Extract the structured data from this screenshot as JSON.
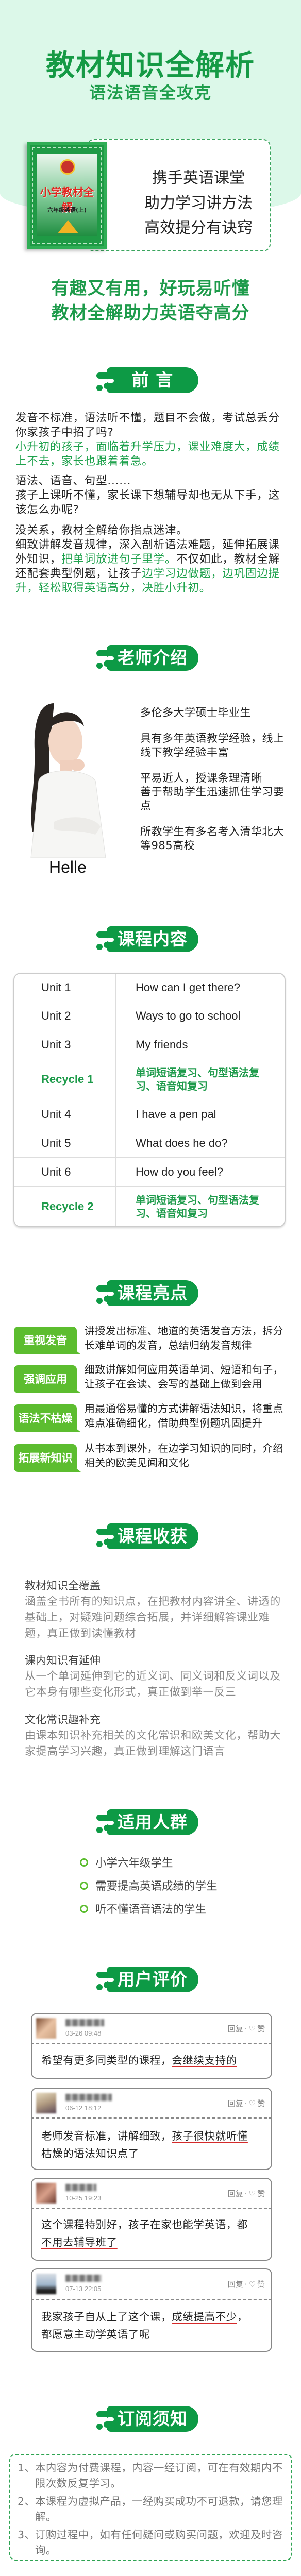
{
  "header": {
    "title": "教材知识全解析",
    "subtitle": "语法语音全攻克"
  },
  "book": {
    "series": "小学教材全解",
    "grade": "六年级英语(上)"
  },
  "promo_box": {
    "lines": [
      "携手英语课堂",
      "助力学习讲方法",
      "高效提分有诀窍"
    ]
  },
  "slogan": {
    "lines": [
      "有趣又有用，好玩易听懂",
      "教材全解助力英语夺高分"
    ]
  },
  "sections": {
    "preface": "前 言",
    "teacher": "老师介绍",
    "content": "课程内容",
    "highlights": "课程亮点",
    "gains": "课程收获",
    "audience": "适用人群",
    "reviews": "用户评价",
    "notice": "订阅须知"
  },
  "preface": {
    "l1": "发音不标准，语法听不懂，题目不会做，考试总丢分",
    "l2": "你家孩子中招了吗?",
    "l3": "小升初的孩子，面临着升学压力，课业难度大，成绩上不去，家长也跟着着急。",
    "l4": "语法、语音、句型......",
    "l5": "孩子上课听不懂，家长课下想辅导却也无从下手，这该怎么办呢?",
    "l6": "没关系，教材全解给你指点迷津。",
    "p_a": "细致讲解发音规律，深入剖析语法难题，延伸拓展课外知识，",
    "p_b": "把单词放进句子里学。",
    "p_c": "不仅如此，教材全解还配套典型例题，让孩子",
    "p_d": "边学习边做题，边巩固边提升，轻松取得英语高分，决胜小升初。"
  },
  "teacher": {
    "name": "Helle",
    "bio": [
      "多伦多大学硕士毕业生",
      "具有多年英语教学经验，线上线下教学经验丰富",
      "平易近人，授课条理清晰",
      "善于帮助学生迅速抓住学习要点",
      "所教学生有多名考入清华北大等985高校"
    ]
  },
  "course_table": [
    {
      "unit": "Unit 1",
      "title": "How can I get there?"
    },
    {
      "unit": "Unit 2",
      "title": "Ways to go to school"
    },
    {
      "unit": "Unit 3",
      "title": "My friends"
    },
    {
      "unit": "Recycle 1",
      "title": "单词短语复习、句型语法复习、语音知复习"
    },
    {
      "unit": "Unit 4",
      "title": "I have a pen pal"
    },
    {
      "unit": "Unit 5",
      "title": "What does he do?"
    },
    {
      "unit": "Unit 6",
      "title": "How do you feel?"
    },
    {
      "unit": "Recycle 2",
      "title": "单词短语复习、句型语法复习、语音知复习"
    }
  ],
  "highlights": [
    {
      "tag": "重视发音",
      "text": "讲授发出标准、地道的英语发音方法，拆分长难单词的发音，总结归纳发音规律"
    },
    {
      "tag": "强调应用",
      "text": "细致讲解如何应用英语单词、短语和句子，让孩子在会读、会写的基础上做到会用"
    },
    {
      "tag": "语法不枯燥",
      "text": "用最通俗易懂的方式讲解语法知识，将重点难点准确细化，借助典型例题巩固提升"
    },
    {
      "tag": "拓展新知识",
      "text": "从书本到课外，在边学习知识的同时，介绍相关的欧美见闻和文化"
    }
  ],
  "gains": [
    {
      "heading": "教材知识全覆盖",
      "body": "涵盖全书所有的知识点，在把教材内容讲全、讲透的基础上，对疑难问题综合拓展，并详细解答课业难题，真正做到读懂教材"
    },
    {
      "heading": "课内知识有延伸",
      "body": "从一个单词延伸到它的近义词、同义词和反义词以及它本身有哪些变化形式，真正做到举一反三"
    },
    {
      "heading": "文化常识趣补充",
      "body": "由课本知识补充相关的文化常识和欧美文化，帮助大家提高学习兴趣，真正做到理解这门语言"
    }
  ],
  "audience": [
    "小学六年级学生",
    "需要提高英语成绩的学生",
    "听不懂语音语法的学生"
  ],
  "review_actions": {
    "reply": "回复",
    "sep": "·",
    "like_icon": "♡",
    "like": "赞"
  },
  "reviews": [
    {
      "date": "03-26  09:48",
      "pre": "希望有更多同类型的课程，",
      "hl": "会继续支持的",
      "post": ""
    },
    {
      "date": "06-12  18:12",
      "pre": "老师发音标准，讲解细致，",
      "hl": "孩子很快就听懂",
      "post": "枯燥的语法知识点了"
    },
    {
      "date": "10-25  19:23",
      "pre": "这个课程特别好，孩子在家也能学英语，都",
      "hl": "不用去辅导班了",
      "post": ""
    },
    {
      "date": "07-13  22:05",
      "pre": "我家孩子自从上了这个课，",
      "hl": "成绩提高不少",
      "post": "，都愿意主动学英语了呢"
    }
  ],
  "notice": [
    {
      "num": "1、",
      "text": "本内容为付费课程，内容一经订阅，可在有效期内不限次数反复学习。"
    },
    {
      "num": "2、",
      "text": "本课程为虚拟产品，一经购买成功不可退款，请您理解。"
    },
    {
      "num": "3、",
      "text": "订购过程中，如有任何疑问或购买问题，欢迎及时咨询。"
    }
  ],
  "colors": {
    "brand_green": "#0d9a45",
    "text_green": "#1e9b4b",
    "tag_green": "#5cbd2f",
    "hero_bg": "#dcf8e9",
    "underline_red": "#d42a2a"
  }
}
